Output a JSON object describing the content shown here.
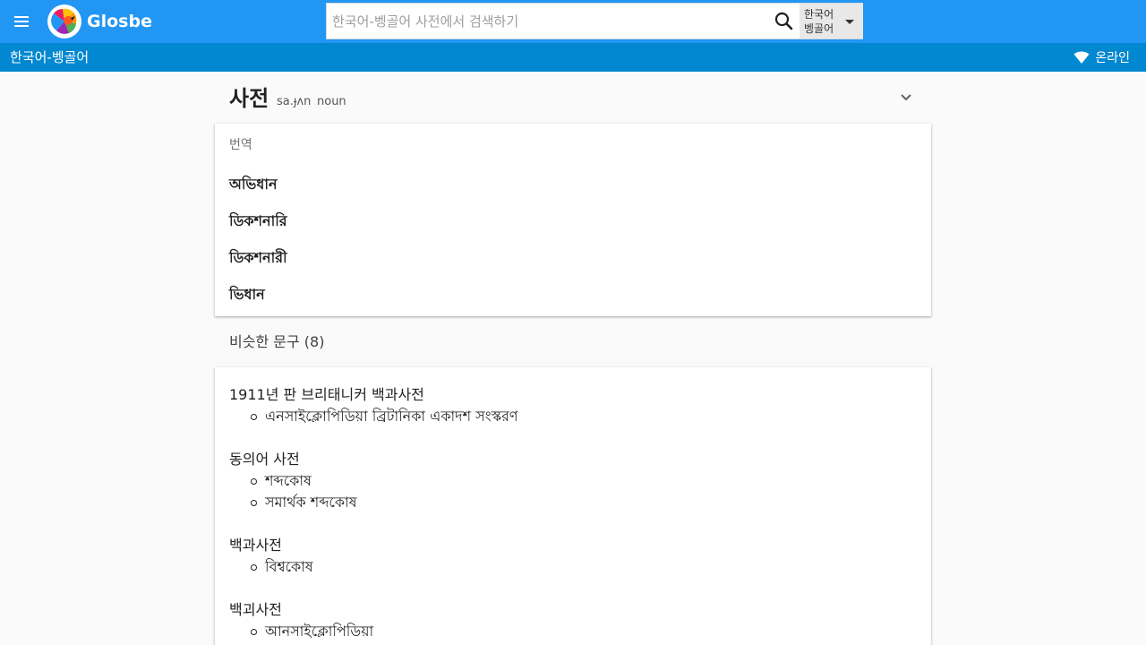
{
  "app": {
    "name": "Glosbe"
  },
  "search": {
    "placeholder": "한국어-벵골어 사전에서 검색하기",
    "value": ""
  },
  "lang_select": {
    "line1": "한국어",
    "line2": "벵골어"
  },
  "subbar": {
    "title": "한국어-벵골어",
    "status": "온라인"
  },
  "entry": {
    "word": "사전",
    "phonetic": "sa.ɟʌn",
    "pos": "noun",
    "translations_label": "번역",
    "translations": [
      "অভিধান",
      "ডিকশনারি",
      "ডিকশনারী",
      "ভিধান"
    ]
  },
  "similar": {
    "title": "비슷한 문구 (8)",
    "phrases": [
      {
        "source": "1911년 판 브리태니커 백과사전",
        "targets": [
          "এনসাইক্লোপিডিয়া ব্রিটানিকা একাদশ সংস্করণ"
        ]
      },
      {
        "source": "동의어 사전",
        "targets": [
          "শব্দকোষ",
          "সমার্থক শব্দকোষ"
        ]
      },
      {
        "source": "백과사전",
        "targets": [
          "বিশ্বকোষ"
        ]
      },
      {
        "source": "백괴사전",
        "targets": [
          "আনসাইক্লোপিডিয়া"
        ]
      }
    ]
  },
  "colors": {
    "topbar": "#2196f3",
    "subbar": "#0288d1",
    "background": "#fafafa"
  },
  "icons": [
    "menu-icon",
    "glosbe-logo-icon",
    "search-icon",
    "dropdown-caret-icon",
    "wifi-icon",
    "chevron-down-icon"
  ]
}
